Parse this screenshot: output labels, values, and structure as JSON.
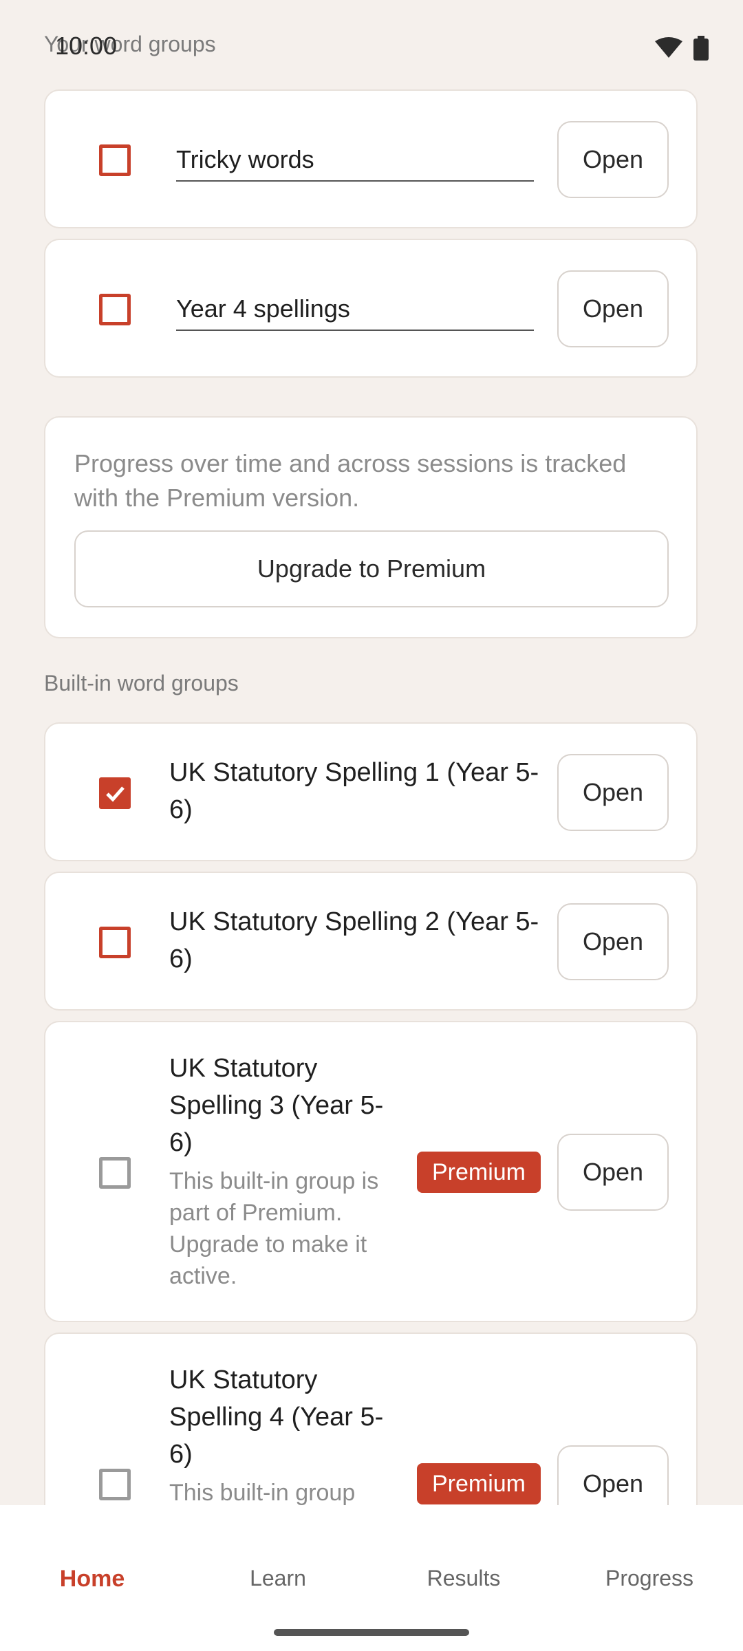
{
  "status_bar": {
    "time": "10:00"
  },
  "sections": {
    "your_groups_label": "Your word groups",
    "builtin_groups_label": "Built-in word groups"
  },
  "custom_groups": [
    {
      "name": "Tricky words",
      "checked": false,
      "open_label": "Open"
    },
    {
      "name": "Year 4 spellings",
      "checked": false,
      "open_label": "Open"
    }
  ],
  "premium_promo": {
    "text": "Progress over time and across sessions is tracked with the Premium version.",
    "button_label": "Upgrade to Premium"
  },
  "builtin_groups": [
    {
      "title": "UK Statutory Spelling 1 (Year 5-6)",
      "checked": true,
      "open_label": "Open"
    },
    {
      "title": "UK Statutory Spelling 2 (Year 5-6)",
      "checked": false,
      "open_label": "Open"
    },
    {
      "title": "UK Statutory Spelling 3 (Year 5-6)",
      "description": "This built-in group is part of Premium. Upgrade to make it active.",
      "badge": "Premium",
      "checked": false,
      "open_label": "Open"
    },
    {
      "title": "UK Statutory Spelling 4 (Year 5-6)",
      "description": "This built-in group",
      "badge": "Premium",
      "checked": false,
      "open_label": "Open"
    }
  ],
  "bottom_nav": {
    "items": [
      {
        "label": "Home",
        "active": true
      },
      {
        "label": "Learn",
        "active": false
      },
      {
        "label": "Results",
        "active": false
      },
      {
        "label": "Progress",
        "active": false
      }
    ]
  },
  "colors": {
    "accent": "#c8402a",
    "background": "#F5F0EC",
    "card": "#ffffff"
  }
}
